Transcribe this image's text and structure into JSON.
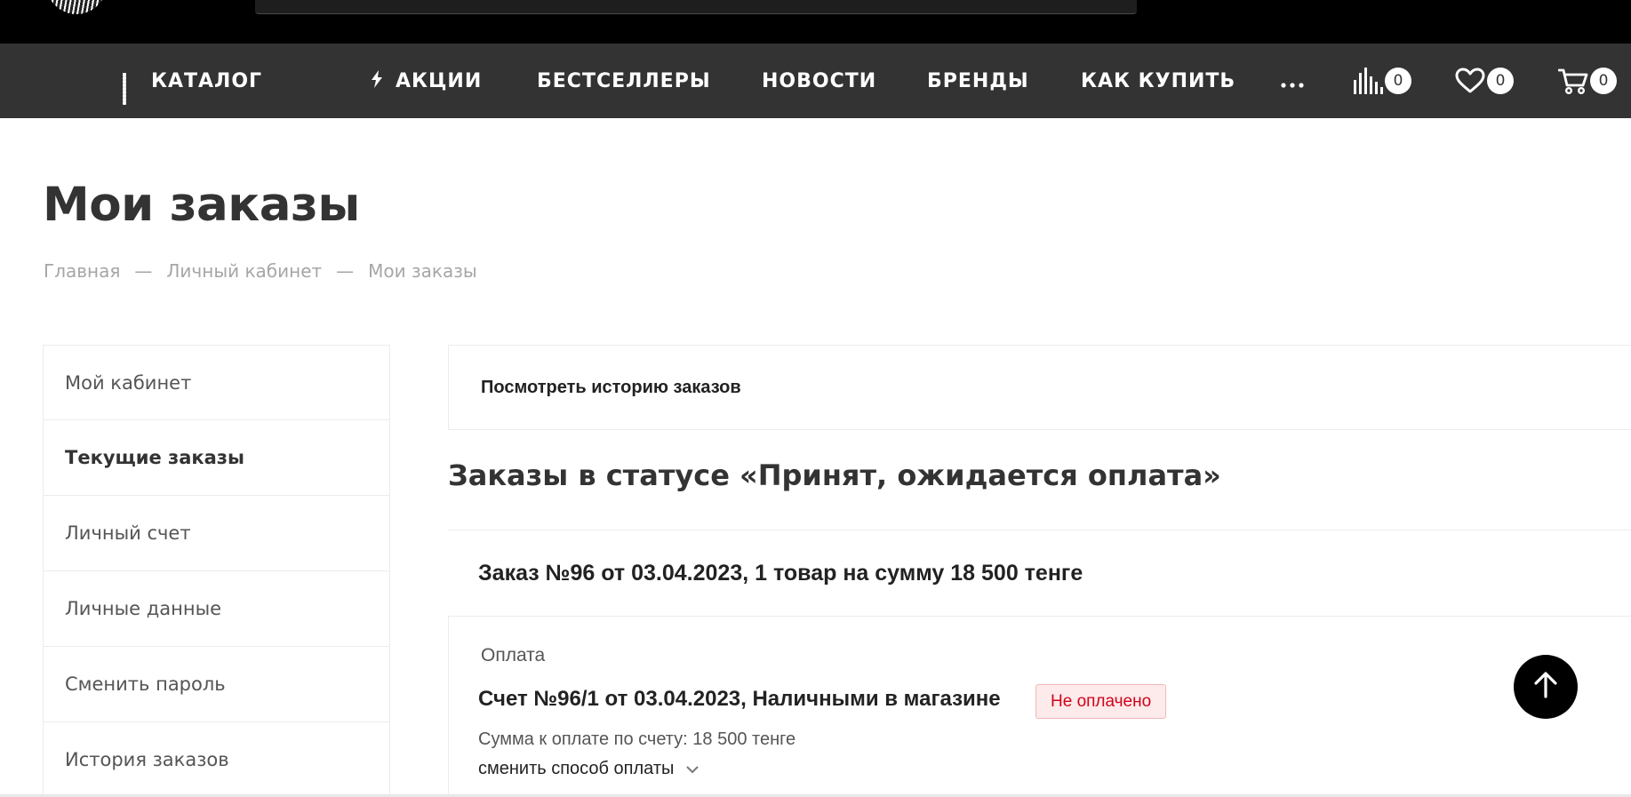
{
  "nav": {
    "catalog": {
      "label": "КАТАЛОГ",
      "icon": "grid-icon"
    },
    "items": [
      {
        "label": "АКЦИИ",
        "icon": "lightning-icon"
      },
      {
        "label": "БЕСТСЕЛЛЕРЫ"
      },
      {
        "label": "НОВОСТИ"
      },
      {
        "label": "БРЕНДЫ"
      },
      {
        "label": "КАК КУПИТЬ"
      }
    ],
    "more_icon": "more-dots-icon",
    "counters": {
      "compare": {
        "icon": "compare-bars-icon",
        "count": "0"
      },
      "favorites": {
        "icon": "heart-icon",
        "count": "0"
      },
      "cart": {
        "icon": "cart-icon",
        "count": "0"
      }
    }
  },
  "page": {
    "title": "Мои заказы",
    "breadcrumbs": [
      "Главная",
      "Личный кабинет",
      "Мои заказы"
    ],
    "breadcrumb_separator": "—"
  },
  "sidebar": {
    "items": [
      {
        "label": "Мой кабинет"
      },
      {
        "label": "Текущие заказы",
        "active": true
      },
      {
        "label": "Личный счет"
      },
      {
        "label": "Личные данные"
      },
      {
        "label": "Сменить пароль"
      },
      {
        "label": "История заказов"
      }
    ]
  },
  "main": {
    "history_link": "Посмотреть историю заказов",
    "status_heading": "Заказы в статусе «Принят, ожидается оплата»",
    "order": {
      "title": "Заказ №96 от 03.04.2023, 1 товар на сумму 18 500 тенге",
      "payment_label": "Оплата",
      "invoice_title": "Счет №96/1 от 03.04.2023, Наличными в магазине",
      "payment_status": "Не оплачено",
      "sum_text": "Сумма к оплате по счету: 18 500 тенге",
      "change_payment": "сменить способ оплаты"
    }
  },
  "colors": {
    "navbar": "#333333",
    "topbar": "#000000",
    "status_unpaid_text": "#d0021b",
    "status_unpaid_bg": "#fdeaea"
  },
  "scroll_top_icon": "arrow-up-icon"
}
